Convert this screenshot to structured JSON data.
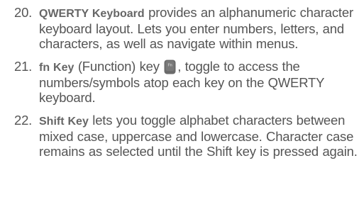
{
  "items": [
    {
      "number": "20.",
      "term": "QWERTY Keyboard",
      "text": " provides an alphanumeric character keyboard layout. Lets you enter numbers, letters, and characters, as well as navigate within menus."
    },
    {
      "number": "21.",
      "term": "fn Key",
      "text_before_icon": " (Function) key ",
      "icon": "fn-key-icon",
      "icon_label": "Fn",
      "text_after_icon": ", toggle to access the numbers/symbols atop each key on the QWERTY keyboard."
    },
    {
      "number": "22.",
      "term": "Shift Key",
      "text": " lets you toggle alphabet characters between mixed case, uppercase and lowercase. Character case remains as selected until the Shift key is pressed again."
    }
  ],
  "colors": {
    "body_text": "#555555",
    "term_text": "#666666",
    "icon_fill": "#6b6b6b",
    "icon_label": "#e6e6e6"
  }
}
